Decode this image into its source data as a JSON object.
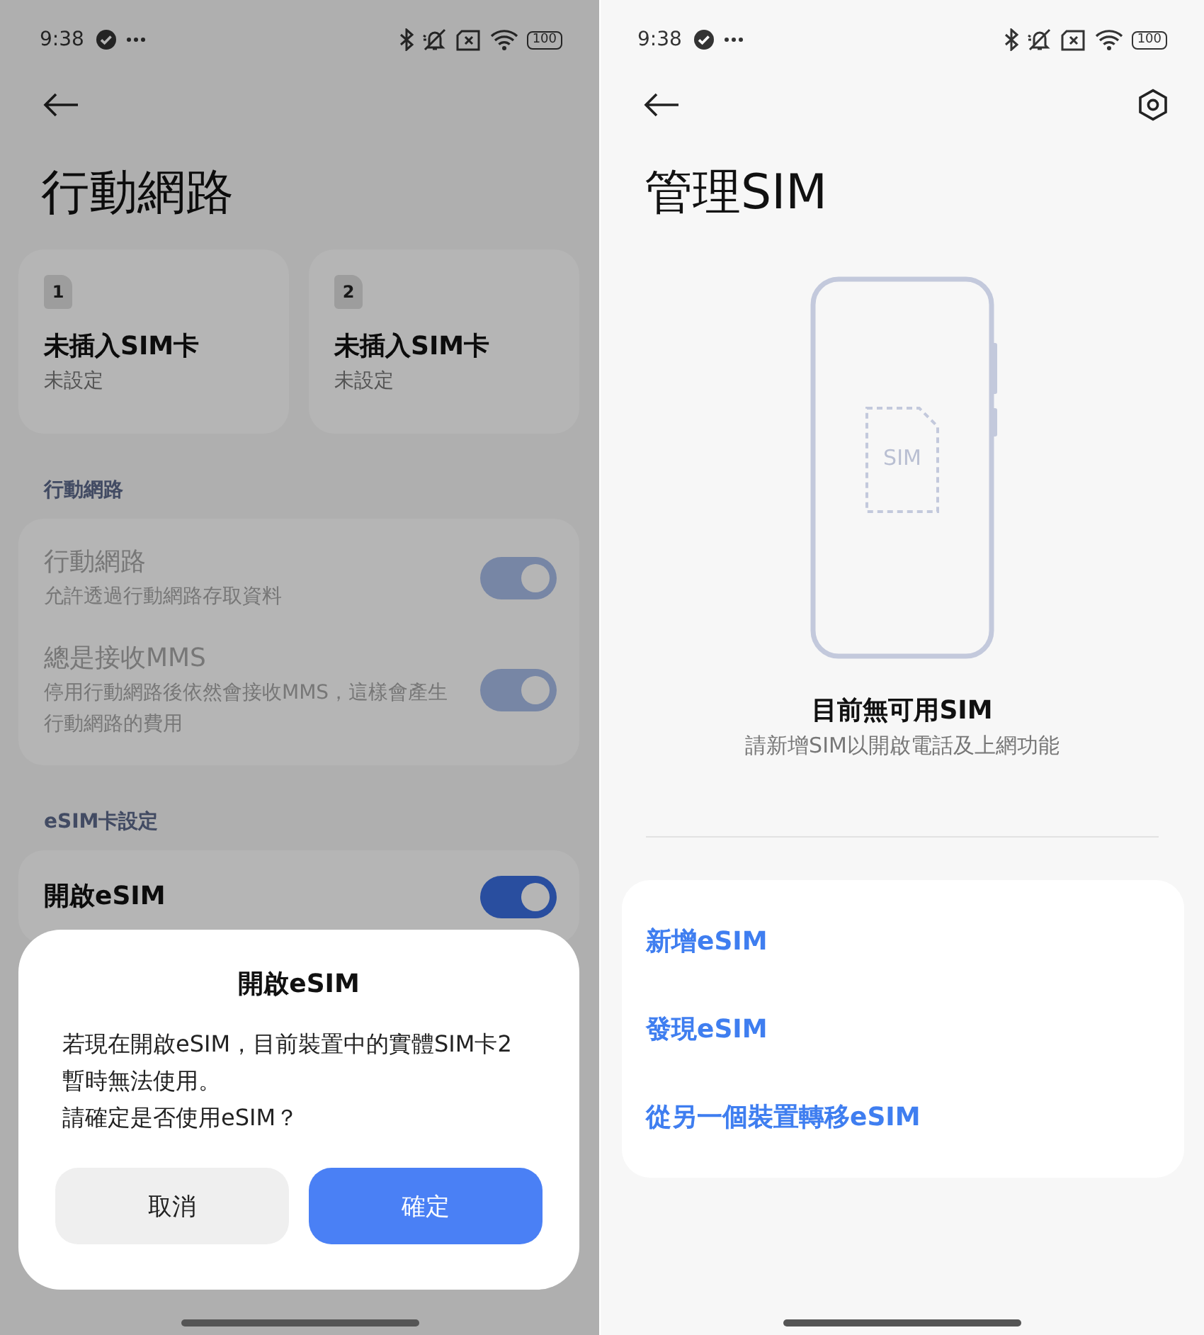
{
  "left_screen": {
    "status_bar": {
      "time": "9:38",
      "battery": "100"
    },
    "title": "行動網路",
    "sim_cards": [
      {
        "slot": "1",
        "status": "未插入SIM卡",
        "detail": "未設定"
      },
      {
        "slot": "2",
        "status": "未插入SIM卡",
        "detail": "未設定"
      }
    ],
    "sections": [
      {
        "header": "行動網路",
        "items": [
          {
            "title": "行動網路",
            "subtitle": "允許透過行動網路存取資料",
            "on": true,
            "disabled": true
          },
          {
            "title": "總是接收MMS",
            "subtitle": "停用行動網路後依然會接收MMS，這樣會產生行動網路的費用",
            "on": true,
            "disabled": true
          }
        ]
      },
      {
        "header": "eSIM卡設定",
        "items": [
          {
            "title": "開啟eSIM",
            "on": true,
            "disabled": false
          }
        ]
      }
    ],
    "dialog": {
      "title": "開啟eSIM",
      "message": [
        "若現在開啟eSIM，目前裝置中的實體SIM卡2暫時無法使用。",
        "請確定是否使用eSIM？"
      ],
      "buttons": [
        {
          "label": "取消",
          "kind": "secondary"
        },
        {
          "label": "確定",
          "kind": "primary"
        }
      ]
    }
  },
  "right_screen": {
    "status_bar": {
      "time": "9:38",
      "battery": "100"
    },
    "title": "管理SIM",
    "illustration": {
      "sim_label": "SIM"
    },
    "empty_title": "目前無可用SIM",
    "empty_subtitle": "請新增SIM以開啟電話及上網功能",
    "actions": [
      {
        "label": "新增eSIM"
      },
      {
        "label": "發現eSIM"
      },
      {
        "label": "從另一個裝置轉移eSIM"
      }
    ]
  }
}
